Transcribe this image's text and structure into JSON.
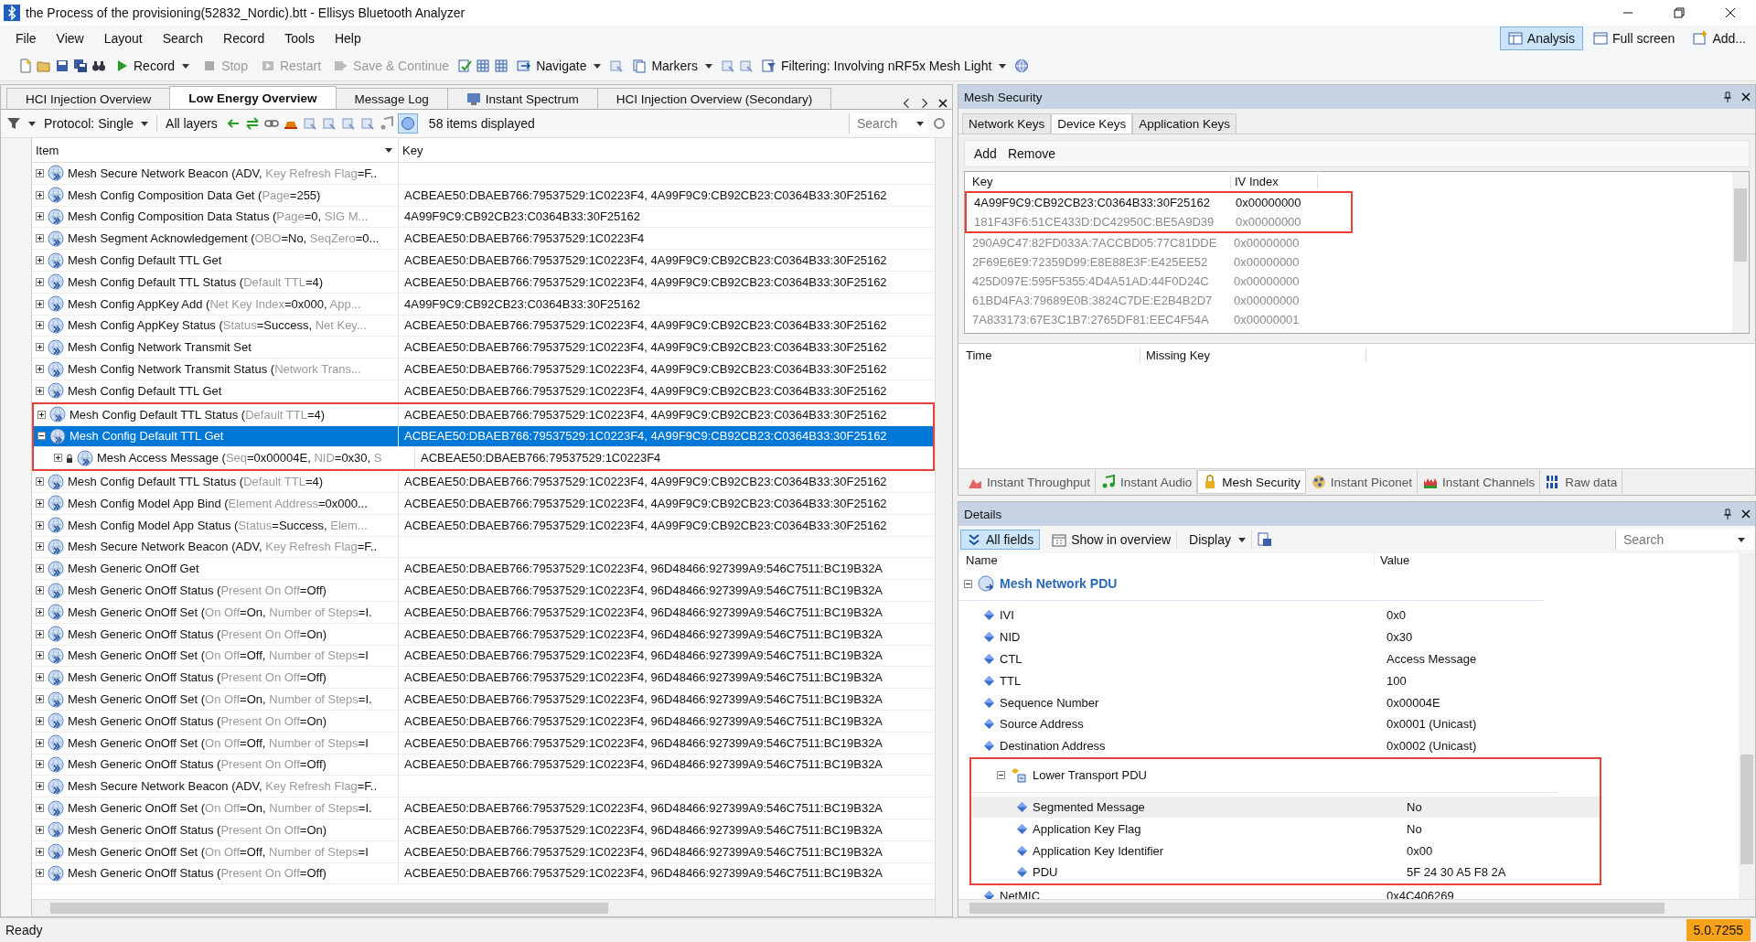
{
  "window": {
    "title": "the Process of the provisioning(52832_Nordic).btt - Ellisys Bluetooth Analyzer"
  },
  "menu": [
    "File",
    "View",
    "Layout",
    "Search",
    "Record",
    "Tools",
    "Help"
  ],
  "view_buttons": [
    {
      "label": "Analysis",
      "selected": true
    },
    {
      "label": "Full screen",
      "selected": false
    },
    {
      "label": "Add...",
      "selected": false
    }
  ],
  "toolbar": [
    {
      "kind": "icon"
    },
    {
      "kind": "icon"
    },
    {
      "kind": "icon"
    },
    {
      "kind": "icon"
    },
    {
      "kind": "icon"
    },
    {
      "kind": "button",
      "label": "Record",
      "dropdown": true,
      "disabled": false
    },
    {
      "kind": "button",
      "label": "Stop",
      "dropdown": false,
      "disabled": true
    },
    {
      "kind": "button",
      "label": "Restart",
      "dropdown": false,
      "disabled": true
    },
    {
      "kind": "button",
      "label": "Save & Continue",
      "dropdown": false,
      "disabled": true
    },
    {
      "kind": "icon"
    },
    {
      "kind": "icon"
    },
    {
      "kind": "icon"
    },
    {
      "kind": "button",
      "label": "Navigate",
      "dropdown": true,
      "disabled": false
    },
    {
      "kind": "icon"
    },
    {
      "kind": "button",
      "label": "Markers",
      "dropdown": true,
      "disabled": false
    },
    {
      "kind": "icon"
    },
    {
      "kind": "icon"
    },
    {
      "kind": "button",
      "label": "Filtering: Involving nRF5x Mesh Light",
      "dropdown": true,
      "disabled": false
    },
    {
      "kind": "icon"
    }
  ],
  "doc_tabs": [
    {
      "label": "HCI Injection Overview",
      "selected": false
    },
    {
      "label": "Low Energy Overview",
      "selected": true
    },
    {
      "label": "Message Log",
      "selected": false
    },
    {
      "label": "Instant Spectrum",
      "selected": false
    },
    {
      "label": "HCI Injection Overview (Secondary)",
      "selected": false
    }
  ],
  "filter_bar": {
    "protocol": "Protocol: Single",
    "layers": "All layers",
    "count": "58 items displayed",
    "search": {
      "placeholder": "Search"
    }
  },
  "columns": [
    "Item",
    "Key"
  ],
  "rows": [
    {
      "parts": [
        "Mesh Secure Network Beacon (ADV, ",
        {
          "dim": "Key Refresh Flag"
        },
        "=F.."
      ],
      "expanded": false,
      "selected": false,
      "framed": false
    },
    {
      "parts": [
        "Mesh Config Composition Data Get (",
        {
          "dim": "Page"
        },
        "=255)"
      ],
      "key": "ACBEAE50:DBAEB766:79537529:1C0223F4, 4A99F9C9:CB92CB23:C0364B33:30F25162",
      "expanded": false,
      "selected": false,
      "framed": false
    },
    {
      "parts": [
        "Mesh Config Composition Data Status (",
        {
          "dim": "Page"
        },
        "=0, ",
        {
          "dim": "SIG M..."
        }
      ],
      "key": "4A99F9C9:CB92CB23:C0364B33:30F25162",
      "expanded": false,
      "selected": false,
      "framed": false
    },
    {
      "parts": [
        "Mesh Segment Acknowledgement (",
        {
          "dim": "OBO"
        },
        "=No, ",
        {
          "dim": "SeqZero"
        },
        "=0..."
      ],
      "key": "ACBEAE50:DBAEB766:79537529:1C0223F4",
      "expanded": false,
      "selected": false,
      "framed": false
    },
    {
      "parts": [
        "Mesh Config Default TTL Get"
      ],
      "key": "ACBEAE50:DBAEB766:79537529:1C0223F4, 4A99F9C9:CB92CB23:C0364B33:30F25162",
      "expanded": false,
      "selected": false,
      "framed": false
    },
    {
      "parts": [
        "Mesh Config Default TTL Status (",
        {
          "dim": "Default TTL"
        },
        "=4)"
      ],
      "key": "ACBEAE50:DBAEB766:79537529:1C0223F4, 4A99F9C9:CB92CB23:C0364B33:30F25162",
      "expanded": false,
      "selected": false,
      "framed": false
    },
    {
      "parts": [
        "Mesh Config AppKey Add (",
        {
          "dim": "Net Key Index"
        },
        "=0x000, ",
        {
          "dim": "App..."
        }
      ],
      "key": "4A99F9C9:CB92CB23:C0364B33:30F25162",
      "expanded": false,
      "selected": false,
      "framed": false
    },
    {
      "parts": [
        "Mesh Config AppKey Status (",
        {
          "dim": "Status"
        },
        "=Success, ",
        {
          "dim": "Net Key..."
        }
      ],
      "key": "ACBEAE50:DBAEB766:79537529:1C0223F4, 4A99F9C9:CB92CB23:C0364B33:30F25162",
      "expanded": false,
      "selected": false,
      "framed": false
    },
    {
      "parts": [
        "Mesh Config Network Transmit Set"
      ],
      "key": "ACBEAE50:DBAEB766:79537529:1C0223F4, 4A99F9C9:CB92CB23:C0364B33:30F25162",
      "expanded": false,
      "selected": false,
      "framed": false
    },
    {
      "parts": [
        "Mesh Config Network Transmit Status (",
        {
          "dim": "Network Trans..."
        }
      ],
      "key": "ACBEAE50:DBAEB766:79537529:1C0223F4, 4A99F9C9:CB92CB23:C0364B33:30F25162",
      "expanded": false,
      "selected": false,
      "framed": false
    },
    {
      "parts": [
        "Mesh Config Default TTL Get"
      ],
      "key": "ACBEAE50:DBAEB766:79537529:1C0223F4, 4A99F9C9:CB92CB23:C0364B33:30F25162",
      "expanded": false,
      "selected": false,
      "framed": false
    },
    {
      "parts": [
        "Mesh Config Default TTL Status (",
        {
          "dim": "Default TTL"
        },
        "=4)"
      ],
      "key": "ACBEAE50:DBAEB766:79537529:1C0223F4, 4A99F9C9:CB92CB23:C0364B33:30F25162",
      "expanded": false,
      "selected": false,
      "framed": true
    },
    {
      "parts": [
        "Mesh Config Default TTL Get"
      ],
      "key": "ACBEAE50:DBAEB766:79537529:1C0223F4, 4A99F9C9:CB92CB23:C0364B33:30F25162",
      "expanded": true,
      "selected": true,
      "framed": true,
      "children": [
        {
          "parts": [
            "Mesh Access Message (",
            {
              "dim": "Seq"
            },
            "=0x00004E, ",
            {
              "dim": "NID"
            },
            "=0x30, ",
            {
              "dim": "S"
            }
          ],
          "key": "ACBEAE50:DBAEB766:79537529:1C0223F4",
          "expanded": false,
          "selected": false
        }
      ]
    },
    {
      "parts": [
        "Mesh Config Default TTL Status (",
        {
          "dim": "Default TTL"
        },
        "=4)"
      ],
      "key": "ACBEAE50:DBAEB766:79537529:1C0223F4, 4A99F9C9:CB92CB23:C0364B33:30F25162",
      "expanded": false,
      "selected": false,
      "framed": false
    },
    {
      "parts": [
        "Mesh Config Model App Bind (",
        {
          "dim": "Element Address"
        },
        "=0x000..."
      ],
      "key": "ACBEAE50:DBAEB766:79537529:1C0223F4, 4A99F9C9:CB92CB23:C0364B33:30F25162",
      "expanded": false,
      "selected": false,
      "framed": false
    },
    {
      "parts": [
        "Mesh Config Model App Status (",
        {
          "dim": "Status"
        },
        "=Success, ",
        {
          "dim": "Elem..."
        }
      ],
      "key": "ACBEAE50:DBAEB766:79537529:1C0223F4, 4A99F9C9:CB92CB23:C0364B33:30F25162",
      "expanded": false,
      "selected": false,
      "framed": false
    },
    {
      "parts": [
        "Mesh Secure Network Beacon (ADV, ",
        {
          "dim": "Key Refresh Flag"
        },
        "=F.."
      ],
      "expanded": false,
      "selected": false,
      "framed": false
    },
    {
      "parts": [
        "Mesh Generic OnOff Get"
      ],
      "key": "ACBEAE50:DBAEB766:79537529:1C0223F4, 96D48466:927399A9:546C7511:BC19B32A",
      "expanded": false,
      "selected": false,
      "framed": false
    },
    {
      "parts": [
        "Mesh Generic OnOff Status (",
        {
          "dim": "Present On Off"
        },
        "=Off)"
      ],
      "key": "ACBEAE50:DBAEB766:79537529:1C0223F4, 96D48466:927399A9:546C7511:BC19B32A",
      "expanded": false,
      "selected": false,
      "framed": false
    },
    {
      "parts": [
        "Mesh Generic OnOff Set (",
        {
          "dim": "On Off"
        },
        "=On, ",
        {
          "dim": "Number of Steps"
        },
        "=I."
      ],
      "key": "ACBEAE50:DBAEB766:79537529:1C0223F4, 96D48466:927399A9:546C7511:BC19B32A",
      "expanded": false,
      "selected": false,
      "framed": false
    },
    {
      "parts": [
        "Mesh Generic OnOff Status (",
        {
          "dim": "Present On Off"
        },
        "=On)"
      ],
      "key": "ACBEAE50:DBAEB766:79537529:1C0223F4, 96D48466:927399A9:546C7511:BC19B32A",
      "expanded": false,
      "selected": false,
      "framed": false
    },
    {
      "parts": [
        "Mesh Generic OnOff Set (",
        {
          "dim": "On Off"
        },
        "=Off, ",
        {
          "dim": "Number of Steps"
        },
        "=I"
      ],
      "key": "ACBEAE50:DBAEB766:79537529:1C0223F4, 96D48466:927399A9:546C7511:BC19B32A",
      "expanded": false,
      "selected": false,
      "framed": false
    },
    {
      "parts": [
        "Mesh Generic OnOff Status (",
        {
          "dim": "Present On Off"
        },
        "=Off)"
      ],
      "key": "ACBEAE50:DBAEB766:79537529:1C0223F4, 96D48466:927399A9:546C7511:BC19B32A",
      "expanded": false,
      "selected": false,
      "framed": false
    },
    {
      "parts": [
        "Mesh Generic OnOff Set (",
        {
          "dim": "On Off"
        },
        "=On, ",
        {
          "dim": "Number of Steps"
        },
        "=I."
      ],
      "key": "ACBEAE50:DBAEB766:79537529:1C0223F4, 96D48466:927399A9:546C7511:BC19B32A",
      "expanded": false,
      "selected": false,
      "framed": false
    },
    {
      "parts": [
        "Mesh Generic OnOff Status (",
        {
          "dim": "Present On Off"
        },
        "=On)"
      ],
      "key": "ACBEAE50:DBAEB766:79537529:1C0223F4, 96D48466:927399A9:546C7511:BC19B32A",
      "expanded": false,
      "selected": false,
      "framed": false
    },
    {
      "parts": [
        "Mesh Generic OnOff Set (",
        {
          "dim": "On Off"
        },
        "=Off, ",
        {
          "dim": "Number of Steps"
        },
        "=I"
      ],
      "key": "ACBEAE50:DBAEB766:79537529:1C0223F4, 96D48466:927399A9:546C7511:BC19B32A",
      "expanded": false,
      "selected": false,
      "framed": false
    },
    {
      "parts": [
        "Mesh Generic OnOff Status (",
        {
          "dim": "Present On Off"
        },
        "=Off)"
      ],
      "key": "ACBEAE50:DBAEB766:79537529:1C0223F4, 96D48466:927399A9:546C7511:BC19B32A",
      "expanded": false,
      "selected": false,
      "framed": false
    },
    {
      "parts": [
        "Mesh Secure Network Beacon (ADV, ",
        {
          "dim": "Key Refresh Flag"
        },
        "=F.."
      ],
      "expanded": false,
      "selected": false,
      "framed": false
    },
    {
      "parts": [
        "Mesh Generic OnOff Set (",
        {
          "dim": "On Off"
        },
        "=On, ",
        {
          "dim": "Number of Steps"
        },
        "=I."
      ],
      "key": "ACBEAE50:DBAEB766:79537529:1C0223F4, 96D48466:927399A9:546C7511:BC19B32A",
      "expanded": false,
      "selected": false,
      "framed": false
    },
    {
      "parts": [
        "Mesh Generic OnOff Status (",
        {
          "dim": "Present On Off"
        },
        "=On)"
      ],
      "key": "ACBEAE50:DBAEB766:79537529:1C0223F4, 96D48466:927399A9:546C7511:BC19B32A",
      "expanded": false,
      "selected": false,
      "framed": false
    },
    {
      "parts": [
        "Mesh Generic OnOff Set (",
        {
          "dim": "On Off"
        },
        "=Off, ",
        {
          "dim": "Number of Steps"
        },
        "=I"
      ],
      "key": "ACBEAE50:DBAEB766:79537529:1C0223F4, 96D48466:927399A9:546C7511:BC19B32A",
      "expanded": false,
      "selected": false,
      "framed": false
    },
    {
      "parts": [
        "Mesh Generic OnOff Status (",
        {
          "dim": "Present On Off"
        },
        "=Off)"
      ],
      "key": "ACBEAE50:DBAEB766:79537529:1C0223F4, 96D48466:927399A9:546C7511:BC19B32A",
      "expanded": false,
      "selected": false,
      "framed": false
    }
  ],
  "mesh_security": {
    "title": "Mesh Security",
    "tabs": [
      {
        "label": "Network Keys",
        "selected": false
      },
      {
        "label": "Device Keys",
        "selected": true
      },
      {
        "label": "Application Keys",
        "selected": false
      }
    ],
    "actions": [
      "Add",
      "Remove"
    ],
    "key_columns": [
      "Key",
      "IV Index"
    ],
    "keys": [
      {
        "key": "4A99F9C9:CB92CB23:C0364B33:30F25162",
        "iv_index": "0x00000000",
        "active": true,
        "framed": true
      },
      {
        "key": "181F43F6:51CE433D:DC42950C:BE5A9D39",
        "iv_index": "0x00000000",
        "active": false,
        "framed": true
      },
      {
        "key": "290A9C47:82FD033A:7ACCBD05:77C81DDE",
        "iv_index": "0x00000000",
        "active": false,
        "framed": false
      },
      {
        "key": "2F69E6E9:72359D99:E8E88E3F:E425EE52",
        "iv_index": "0x00000000",
        "active": false,
        "framed": false
      },
      {
        "key": "425D097E:595F5355:4D4A51AD:44F0D24C",
        "iv_index": "0x00000000",
        "active": false,
        "framed": false
      },
      {
        "key": "61BD4FA3:79689E0B:3824C7DE:E2B4B2D7",
        "iv_index": "0x00000000",
        "active": false,
        "framed": false
      },
      {
        "key": "7A833173:67E3C1B7:2765DF81:EEC4F54A",
        "iv_index": "0x00000001",
        "active": false,
        "framed": false
      }
    ],
    "missing_columns": [
      "Time",
      "Missing Key"
    ]
  },
  "tool_tabs": [
    {
      "label": "Instant Throughput",
      "selected": false
    },
    {
      "label": "Instant Audio",
      "selected": false
    },
    {
      "label": "Mesh Security",
      "selected": true
    },
    {
      "label": "Instant Piconet",
      "selected": false
    },
    {
      "label": "Instant Channels",
      "selected": false
    },
    {
      "label": "Raw data",
      "selected": false
    }
  ],
  "details": {
    "title": "Details",
    "toolbar": [
      {
        "label": "All fields",
        "selected": true,
        "dropdown": false
      },
      {
        "label": "Show in overview",
        "selected": false,
        "dropdown": false
      },
      {
        "label": "Display",
        "selected": false,
        "dropdown": true
      }
    ],
    "search": {
      "placeholder": "Search"
    },
    "columns": [
      "Name",
      "Value"
    ],
    "tree": [
      {
        "kind": "section",
        "name": "Mesh Network PDU",
        "expanded": true,
        "framed": false,
        "selected": false,
        "children": [
          {
            "kind": "field",
            "name": "IVI",
            "value": "0x0",
            "selected": false
          },
          {
            "kind": "field",
            "name": "NID",
            "value": "0x30",
            "selected": false
          },
          {
            "kind": "field",
            "name": "CTL",
            "value": "Access Message",
            "selected": false
          },
          {
            "kind": "field",
            "name": "TTL",
            "value": "100",
            "selected": false
          },
          {
            "kind": "field",
            "name": "Sequence Number",
            "value": "0x00004E",
            "selected": false
          },
          {
            "kind": "field",
            "name": "Source Address",
            "value": "0x0001 (Unicast)",
            "selected": false
          },
          {
            "kind": "field",
            "name": "Destination Address",
            "value": "0x0002 (Unicast)",
            "selected": false
          },
          {
            "kind": "group",
            "name": "Lower Transport PDU",
            "expanded": true,
            "framed": true,
            "selected": false,
            "children": [
              {
                "kind": "field",
                "name": "Segmented Message",
                "value": "No",
                "selected": true
              },
              {
                "kind": "field",
                "name": "Application Key Flag",
                "value": "No",
                "selected": false
              },
              {
                "kind": "field",
                "name": "Application Key Identifier",
                "value": "0x00",
                "selected": false
              },
              {
                "kind": "field",
                "name": "PDU",
                "value": "5F 24 30 A5 F8 2A",
                "selected": false
              }
            ]
          },
          {
            "kind": "field",
            "name": "NetMIC",
            "value": "0x4C406269",
            "selected": false
          }
        ]
      }
    ]
  },
  "status_bar": {
    "text": "Ready",
    "version": "5.0.7255"
  }
}
